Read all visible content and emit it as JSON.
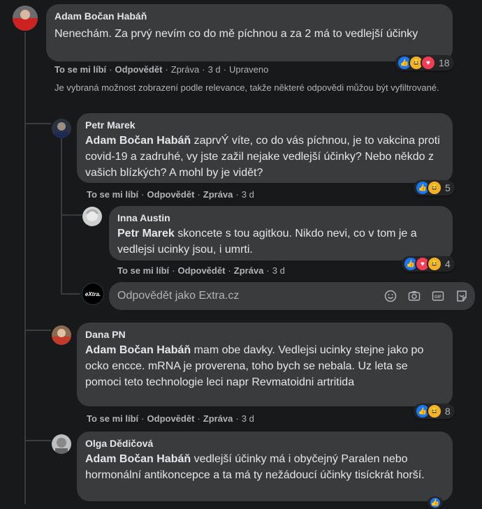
{
  "comments": {
    "top": {
      "author": "Adam Bočan Habáň",
      "text": "Nenechám. Za prvý nevím co do mě píchnou a za 2 má to vedlejší účinky",
      "actions": {
        "like": "To se mi líbí",
        "reply": "Odpovědět",
        "message": "Zpráva",
        "time": "3 d",
        "edited": "Upraveno"
      },
      "reaction_count": "18"
    },
    "notice": "Je vybraná možnost zobrazení podle relevance, takže některé odpovědi můžou být vyfiltrované.",
    "petr": {
      "author": "Petr Marek",
      "mention": "Adam Bočan Habáň",
      "text": " zaprvÝ víte, co do vás píchnou, je to vakcina proti covid-19 a zadruhé, vy jste zažil nejake vedlejší účinky? Nebo někdo z vašich blízkých? A mohl by je vidět?",
      "actions": {
        "like": "To se mi líbí",
        "reply": "Odpovědět",
        "message": "Zpráva",
        "time": "3 d"
      },
      "reaction_count": "5"
    },
    "inna": {
      "author": "Inna Austin",
      "mention": "Petr Marek",
      "text": " skoncete s tou agitkou. Nikdo nevi, co v tom je a vedlejsi ucinky jsou, i umrti.",
      "actions": {
        "like": "To se mi líbí",
        "reply": "Odpovědět",
        "message": "Zpráva",
        "time": "3 d"
      },
      "reaction_count": "4"
    },
    "reply_box": {
      "placeholder": "Odpovědět jako Extra.cz",
      "avatar_label": "eXtra."
    },
    "dana": {
      "author": "Dana PN",
      "mention": "Adam Bočan Habáň",
      "text": " mam obe davky. Vedlejsi ucinky stejne jako po ocko encce. mRNA je proverena, toho bych se nebala. Uz leta se pomoci teto technologie leci napr Revmatoidni artritida",
      "actions": {
        "like": "To se mi líbí",
        "reply": "Odpovědět",
        "message": "Zpráva",
        "time": "3 d"
      },
      "reaction_count": "8"
    },
    "olga": {
      "author": "Olga Dědičová",
      "mention": "Adam Bočan Habáň",
      "text": " vedlejší účinky má i obyčejný Paralen nebo hormonální antikoncepce a ta má ty nežádoucí účinky tisíckrát horší."
    }
  },
  "colors": {
    "like": "#1877f2",
    "haha": "#f7b125",
    "love": "#f33e58",
    "bubble": "#3a3b3c",
    "background": "#18191a"
  }
}
